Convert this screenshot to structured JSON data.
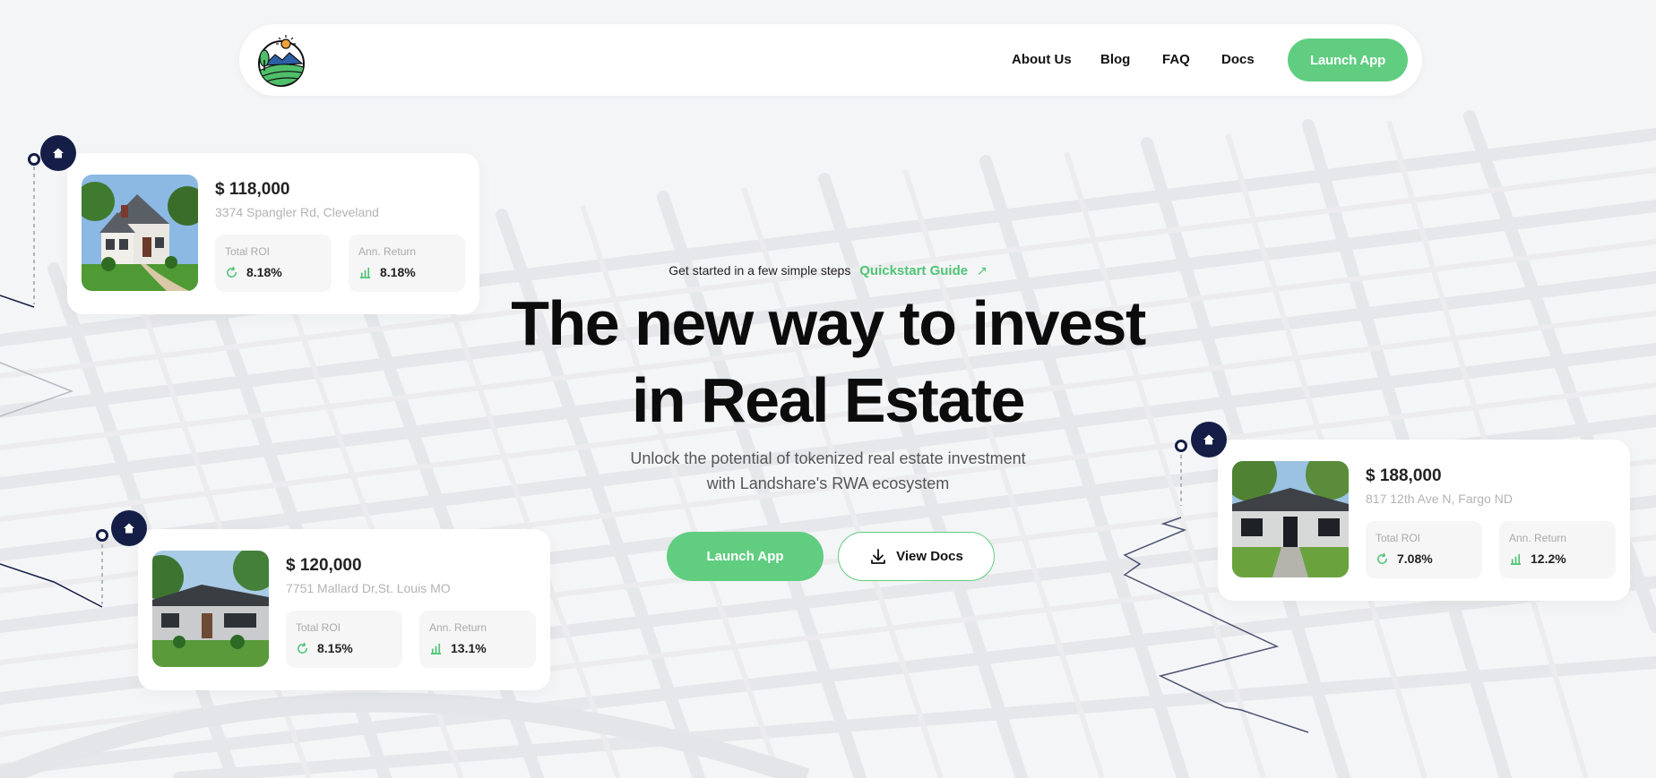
{
  "nav": {
    "links": [
      "About Us",
      "Blog",
      "FAQ",
      "Docs"
    ],
    "launch_label": "Launch App"
  },
  "hero": {
    "tagline": "Get started in a few simple steps",
    "guide_link": "Quickstart Guide",
    "headline_line1": "The new way to invest",
    "headline_line2": "in Real Estate",
    "subtitle_line1": "Unlock the potential of tokenized real estate investment",
    "subtitle_line2": "with Landshare's RWA ecosystem",
    "launch_label": "Launch App",
    "docs_label": "View Docs"
  },
  "properties": [
    {
      "price": "$ 118,000",
      "address": "3374 Spangler Rd, Cleveland",
      "roi_label": "Total ROI",
      "roi": "8.18%",
      "return_label": "Ann. Return",
      "return": "8.18%"
    },
    {
      "price": "$ 120,000",
      "address": "7751 Mallard Dr,St. Louis MO",
      "roi_label": "Total ROI",
      "roi": "8.15%",
      "return_label": "Ann. Return",
      "return": "13.1%"
    },
    {
      "price": "$ 188,000",
      "address": "817 12th Ave N, Fargo ND",
      "roi_label": "Total ROI",
      "roi": "7.08%",
      "return_label": "Ann. Return",
      "return": "12.2%"
    }
  ],
  "colors": {
    "accent": "#61cd81",
    "navy": "#141e46"
  },
  "icons": [
    "home-icon",
    "refresh-icon",
    "bar-chart-icon",
    "download-icon",
    "arrow-up-right-icon"
  ]
}
